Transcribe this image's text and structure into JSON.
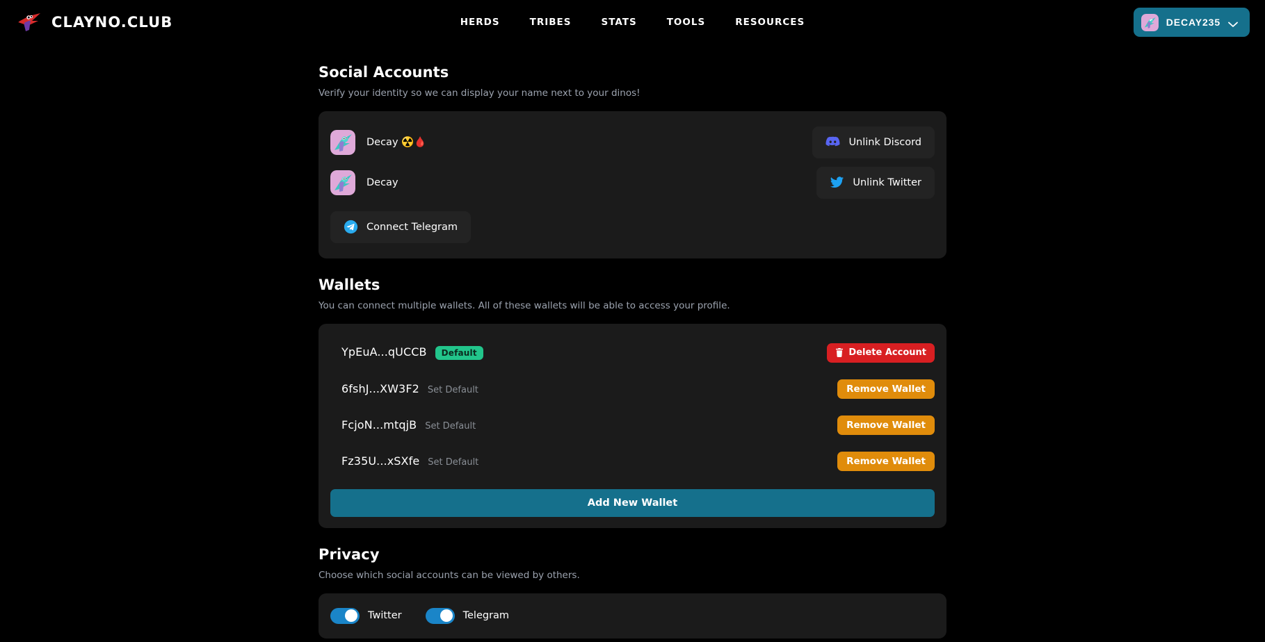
{
  "header": {
    "brand_name": "CLAYNO.CLUB",
    "logo_icon": "pterodactyl-logo-icon",
    "nav": [
      {
        "label": "HERDS"
      },
      {
        "label": "TRIBES"
      },
      {
        "label": "STATS"
      },
      {
        "label": "TOOLS"
      },
      {
        "label": "RESOURCES"
      }
    ],
    "profile": {
      "name": "DECAY235",
      "avatar_icon": "dino-avatar",
      "chevron_icon": "chevron-down-icon",
      "accent_color": "#15708c"
    }
  },
  "social": {
    "title": "Social Accounts",
    "description": "Verify your identity so we can display your name next to your dinos!",
    "accounts": [
      {
        "platform": "discord",
        "username": "Decay ☢️🩸",
        "avatar_icon": "dino-avatar",
        "action_label": "Unlink Discord",
        "action_icon": "discord-icon",
        "icon_color": "#5865F2",
        "linked": true
      },
      {
        "platform": "twitter",
        "username": "Decay",
        "avatar_icon": "dino-avatar",
        "action_label": "Unlink Twitter",
        "action_icon": "twitter-icon",
        "icon_color": "#1DA1F2",
        "linked": true
      }
    ],
    "telegram": {
      "platform": "telegram",
      "action_label": "Connect Telegram",
      "action_icon": "telegram-icon",
      "icon_color": "#2AABEE",
      "linked": false
    }
  },
  "wallets": {
    "title": "Wallets",
    "description": "You can connect multiple wallets. All of these wallets will be able to access your profile.",
    "set_default_label": "Set Default",
    "default_badge_label": "Default",
    "default_badge_color": "#22c58b",
    "delete_account_label": "Delete Account",
    "delete_account_icon": "trash-icon",
    "delete_account_color": "#d81f22",
    "remove_wallet_label": "Remove Wallet",
    "remove_wallet_color": "#e08c0b",
    "add_wallet_label": "Add New Wallet",
    "add_wallet_color": "#15708c",
    "rows": [
      {
        "address": "YpEuA...qUCCB",
        "is_default": true,
        "action": "Delete Account"
      },
      {
        "address": "6fshJ...XW3F2",
        "is_default": false,
        "action": "Remove Wallet"
      },
      {
        "address": "FcjoN...mtqjB",
        "is_default": false,
        "action": "Remove Wallet"
      },
      {
        "address": "Fz35U...xSXfe",
        "is_default": false,
        "action": "Remove Wallet"
      }
    ]
  },
  "privacy": {
    "title": "Privacy",
    "description": "Choose which social accounts can be viewed by others.",
    "toggle_on_color": "#1a85c8",
    "toggles": [
      {
        "label": "Twitter",
        "enabled": true
      },
      {
        "label": "Telegram",
        "enabled": true
      }
    ]
  }
}
